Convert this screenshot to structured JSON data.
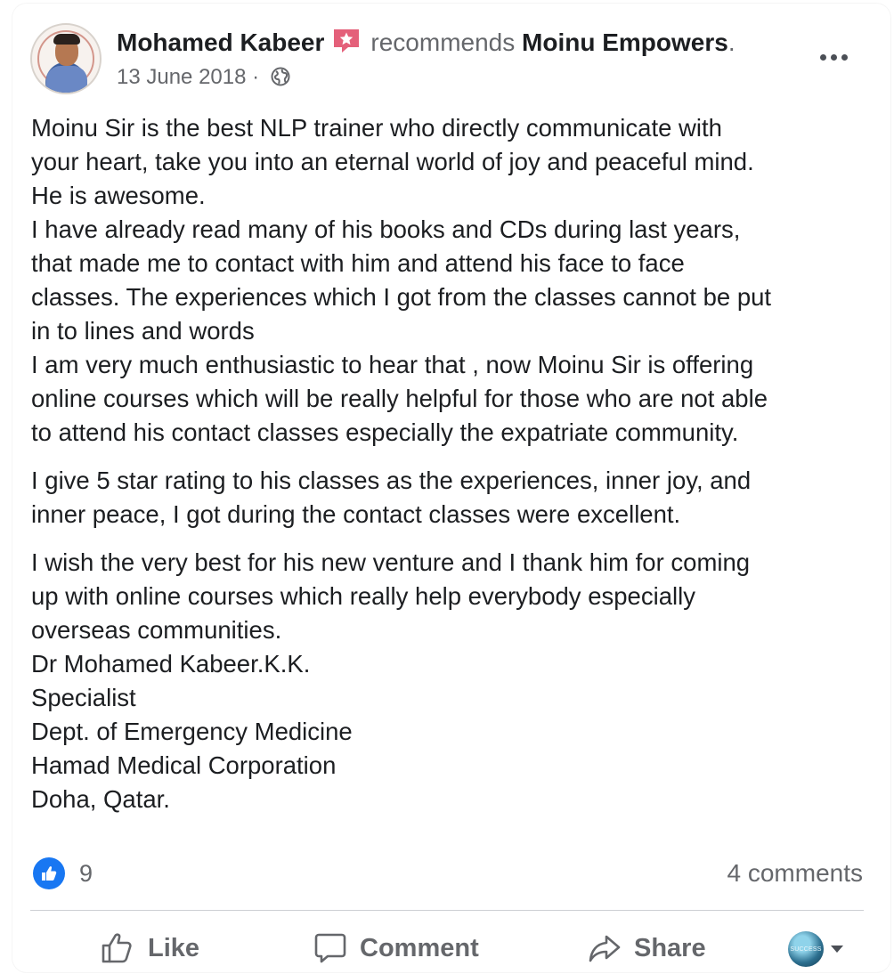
{
  "post": {
    "author": "Mohamed Kabeer",
    "action": "recommends",
    "page": "Moinu Empowers",
    "page_suffix": ".",
    "date": "13 June 2018",
    "date_separator": "·",
    "privacy_icon": "globe-icon",
    "more_icon": "more-options-icon"
  },
  "body": {
    "lines_block1": [
      "Moinu Sir is the best NLP trainer who directly communicate with",
      "your heart, take you into an eternal world of joy and peaceful mind.",
      "He is awesome.",
      "I have already read many of his books and CDs during last years,",
      "that made me to contact with him and attend his face to face",
      "classes. The experiences which I got from the classes cannot be put",
      "in to lines and words",
      "I am very much enthusiastic to hear that , now Moinu Sir is offering",
      "online courses which will be really helpful for those who are not able",
      "to attend his contact classes especially the expatriate community."
    ],
    "lines_block2": [
      "I give 5 star rating to his classes as the experiences, inner joy, and",
      "inner peace, I got during the contact classes were excellent."
    ],
    "lines_block3": [
      "I wish the very best for his new venture and I  thank him for coming",
      "up with  online courses which really help everybody especially",
      "overseas communities.",
      "Dr Mohamed Kabeer.K.K.",
      "Specialist",
      "Dept. of Emergency Medicine",
      "Hamad Medical Corporation",
      "Doha, Qatar."
    ]
  },
  "stats": {
    "reaction_icon": "like-reaction-icon",
    "reaction_count": "9",
    "comments": "4 comments"
  },
  "actions": {
    "like": "Like",
    "comment": "Comment",
    "share": "Share",
    "profile_label": "SUCCESS"
  },
  "colors": {
    "brand_blue": "#1877f2",
    "secondary_text": "#65676b",
    "primary_text": "#1c1e21",
    "badge_pink": "#e4607a"
  }
}
